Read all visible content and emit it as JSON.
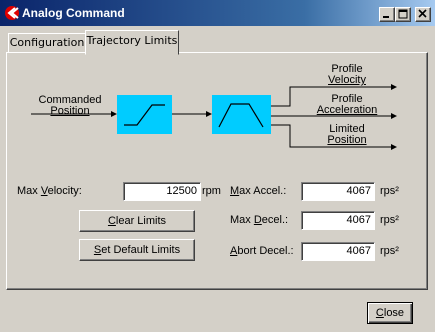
{
  "window": {
    "title": "Analog Command",
    "icon": "app-logo-icon"
  },
  "tabs": [
    {
      "label": "Configuration",
      "active": false
    },
    {
      "label": "Trajectory Limits",
      "active": true
    }
  ],
  "diagram": {
    "input_label_line1": "Commanded",
    "input_label_line2": "Position",
    "output1_line1": "Profile",
    "output1_line2": "Velocity",
    "output2_line1": "Profile",
    "output2_line2": "Acceleration",
    "output3_line1": "Limited",
    "output3_line2": "Position",
    "block_color": "#00ccff"
  },
  "velocity": {
    "label_pre": "Max ",
    "label_ul": "V",
    "label_post": "elocity:",
    "value": "12500",
    "unit": "rpm"
  },
  "accel": {
    "label_ul": "M",
    "label_post": "ax Accel.:",
    "value": "4067",
    "unit": "rps²"
  },
  "decel": {
    "label_pre": "Max ",
    "label_ul": "D",
    "label_post": "ecel.:",
    "value": "4067",
    "unit": "rps²"
  },
  "abort": {
    "label_ul": "A",
    "label_post": "bort Decel.:",
    "value": "4067",
    "unit": "rps²"
  },
  "buttons": {
    "clear_pre": "",
    "clear_ul": "C",
    "clear_post": "lear Limits",
    "default_pre": "",
    "default_ul": "S",
    "default_post": "et Default Limits",
    "close_ul": "C",
    "close_post": "lose"
  }
}
